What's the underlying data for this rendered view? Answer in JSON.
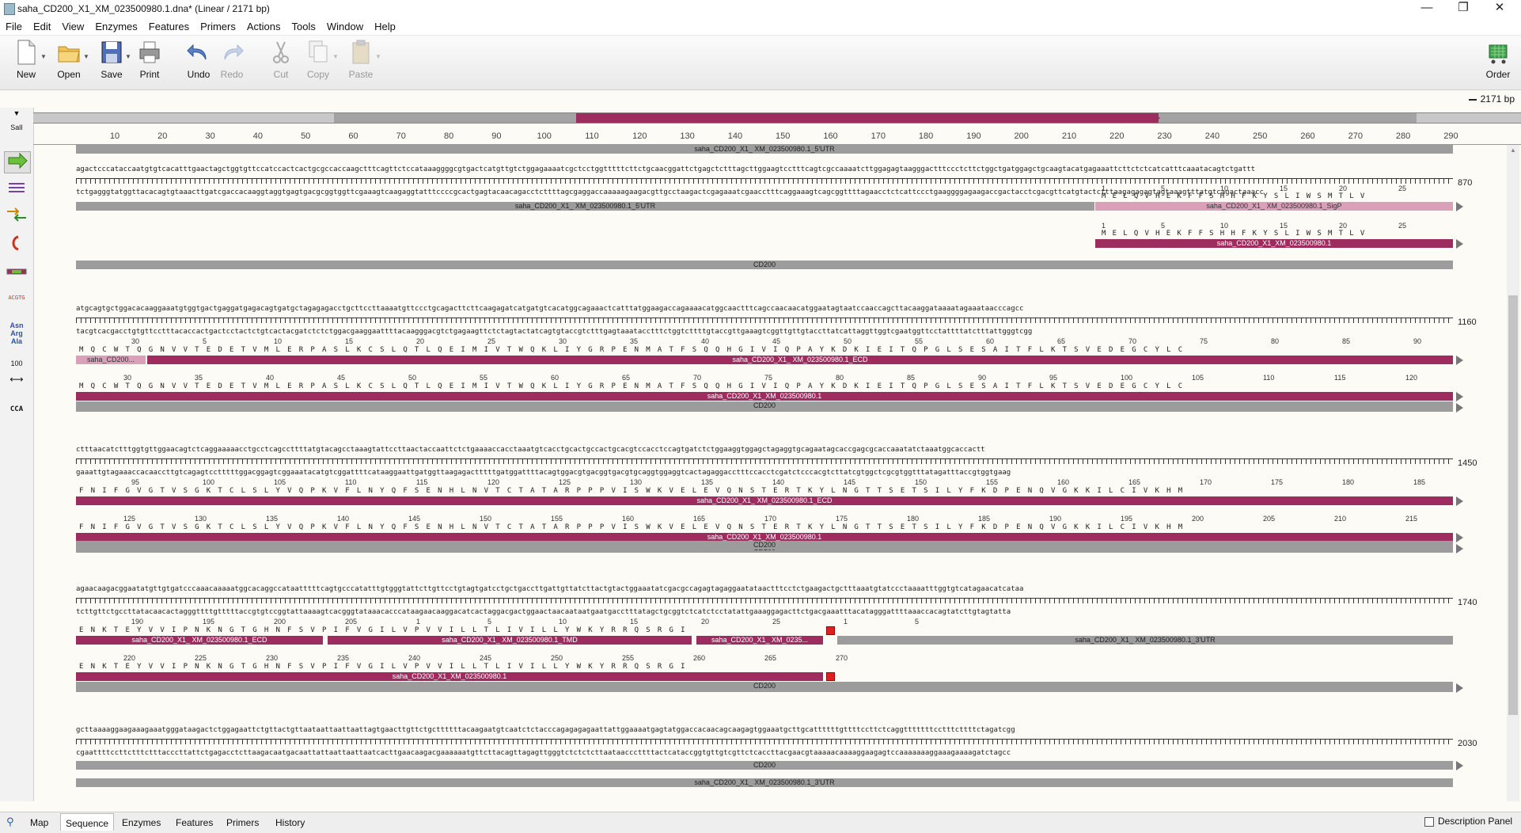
{
  "window": {
    "title": "saha_CD200_X1_XM_023500980.1.dna*  (Linear / 2171 bp)",
    "minimize": "—",
    "restore": "❐",
    "close": "✕"
  },
  "menu": [
    "File",
    "Edit",
    "View",
    "Enzymes",
    "Features",
    "Primers",
    "Actions",
    "Tools",
    "Window",
    "Help"
  ],
  "toolbar": {
    "new": "New",
    "open": "Open",
    "save": "Save",
    "print": "Print",
    "undo": "Undo",
    "redo": "Redo",
    "cut": "Cut",
    "copy": "Copy",
    "paste": "Paste",
    "order": "Order"
  },
  "length_label": "2171 bp",
  "sidebar": {
    "restriction": "SalI",
    "dna_icon": "ACGTG",
    "aa_icon1": "Asn",
    "aa_icon2": "Arg",
    "aa_icon3": "Ala",
    "scale": "100",
    "codon": "CCA"
  },
  "ruler": [
    "10",
    "20",
    "30",
    "40",
    "50",
    "60",
    "70",
    "80",
    "90",
    "100",
    "110",
    "120",
    "130",
    "140",
    "150",
    "160",
    "170",
    "180",
    "190",
    "200",
    "210",
    "220",
    "230",
    "240",
    "250",
    "260",
    "270",
    "280",
    "290"
  ],
  "features": {
    "utr5": "saha_CD200_X1_ XM_023500980.1_5'UTR",
    "sigp": "saha_CD200_X1_ XM_023500980.1_SigP",
    "cds": "saha_CD200_X1_XM_023500980.1",
    "cds2": "saha_CD200_X1_ XM_023500980.1",
    "gene": "CD200",
    "ecd": "saha_CD200_X1_ XM_023500980.1_ECD",
    "ecd_short": "saha_CD200...",
    "tmd": "saha_CD200_X1_ XM_023500980.1_TMD",
    "short": "saha_CD200_X1_ XM_0235...",
    "utr3": "saha_CD200_X1_ XM_023500980.1_3'UTR"
  },
  "rows": [
    {
      "pos": "870",
      "top": "agactcccataccaatgtgtcacatttgaactagctggtgttccatccactcactgcgccaccaagctttcagttctccataaaggggcgtgactcatgttgtctggagaaaatcgctcctggtttttcttctgcaacggattctgagctctttagcttggaagtcctttcagtcgccaaaatcttggagagtaagggactttccctcttctggctgatggagctgcaagtacatgagaaattcttctctcatcatttcaaatacagtctgattt",
      "bot": "tctgagggtatggttacacagtgtaaacttgatcgaccacaaggtaggtgagtgacgcggtggttcgaaagtcaagaggtatttccccgcactgagtacaacagacctcttttagcgaggaccaaaaagaagacgttgcctaagactcgagaaatcgaacctttcaggaaagtcagcggttttagaacctctcattccctgaaggggagaagaccgactacctcgacgttcatgtactctttaagagagagtagtaaagtttatgtcagactaaacc",
      "aa": "MELQVHEKFFSHHFKYSLIWSMTLV",
      "aanums": [
        "1",
        "5",
        "10",
        "15",
        "20",
        "25"
      ]
    },
    {
      "pos": "1160",
      "top": "atgcagtgctggacacaaggaaatgtggtgactgaggatgagacagtgatgctagagagacctgcttccttaaaatgttccctgcagacttcttcaagagatcatgatgtcacatggcagaaactcatttatggaagaccagaaaacatggcaactttcagccaacaacatggaatagtaatccaaccagcttacaaggataaaatagaaataacccagcc",
      "bot": "tacgtcacgacctgtgttcctttacaccactgactcctactctgtcactacgatctctctggacgaaggaattttacaagggacgtctgagaagttctctagtactatcagtgtaccgtctttgagtaaatacctttctggtcttttgtaccgttgaaagtcggttgttgtaccttatcattaggttggtcgaatggttcctattttatctttattgggtcgg",
      "aa": "MQCWTQGNVVTEDETVMLERPASLKCSLQTLQEIMIVTWQKLIYGRPENMATFSQQHGIVIQPAYKDKIEITQPGLSESAITFLKTSVEDEGCYLC",
      "aanums": [
        "30",
        "5",
        "10",
        "15",
        "20",
        "25",
        "30",
        "35",
        "40",
        "45",
        "50",
        "55",
        "60",
        "65",
        "70",
        "75",
        "80",
        "85",
        "90"
      ],
      "aanums2": [
        "30",
        "35",
        "40",
        "45",
        "50",
        "55",
        "60",
        "65",
        "70",
        "75",
        "80",
        "85",
        "90",
        "95",
        "100",
        "105",
        "110",
        "115",
        "120"
      ]
    },
    {
      "pos": "1450",
      "top": "ctttaacatctttggtgttggaacagtctcaggaaaaacctgcctcagccttttatgtacagcctaaagtattccttaactaccaattctctgaaaaccacctaaatgtcacctgcactgccactgcacgtccacctccagtgatctctggaaggtggagctagaggtgcagaatagcaccgagcgcaccaaatatctaaatggcaccactt",
      "bot": "gaaattgtagaaaccacaaccttgtcagagtcctttttggacggagtcggaaatacatgtcggattttcataaggaattgatggttaagagactttttgatggattttacagtggacgtgacggtgacgtgcaggtggaggtcactagaggacctttccacctcgatctcccacgtcttatcgtggctcgcgtggtttatagatttaccgtggtgaag",
      "aa": "FNIFGVGTVSGKTCLSLYVQPKVFLNYQFSENHLNVTCTATARPPPVISWKVELEVQNSTERTKYLNGTTSETSILYFKDPENQVGKKILCIVKHM",
      "aanums": [
        "95",
        "100",
        "105",
        "110",
        "115",
        "120",
        "125",
        "130",
        "135",
        "140",
        "145",
        "150",
        "155",
        "160",
        "165",
        "170",
        "175",
        "180",
        "185"
      ],
      "aanums2": [
        "125",
        "130",
        "135",
        "140",
        "145",
        "150",
        "155",
        "160",
        "165",
        "170",
        "175",
        "180",
        "185",
        "190",
        "195",
        "200",
        "205",
        "210",
        "215"
      ]
    },
    {
      "pos": "1740",
      "top": "agaacaagacggaatatgttgtgatcccaaacaaaaatggcacaggccataatttttcagtgcccatatttgtgggtattcttgttcctgtagtgatcctgctgaccttgattgttatcttactgtactggaaatatcgacgccagagtagaggaatataactttcctctgaagactgctttaaatgtatccctaaaatttggtgtcatagaacatcataa",
      "bot": "tcttgttctgccttatacaacactagggttttgtttttaccgtgtccggtattaaaagtcacgggtataaacacccataagaacaaggacatcactaggacgactggaactaacaataatgaatgacctttatagctgcggtctcatctcctatattgaaaggagacttctgacgaaatttacatagggattttaaaccacagtatcttgtagtatta",
      "aa": "ENKTEYVVIPNKNGTGHNFSVPIFVGILVPVVILLTLIVILLYWKYRRQSRGI",
      "aanums": [
        "190",
        "195",
        "200",
        "205",
        "1",
        "5",
        "10",
        "15",
        "20",
        "25",
        "1",
        "5"
      ],
      "aanums2": [
        "220",
        "225",
        "230",
        "235",
        "240",
        "245",
        "250",
        "255",
        "260",
        "265",
        "270"
      ]
    },
    {
      "pos": "2030",
      "top": "gcttaaaaggaagaaagaaatgggataagactctggagaattctgttactgttaataattaattaattagtgaacttgttctgcttttttacaagaatgtcaatctctacccagagagagaattattggaaaatgagtatggaccacaacagcaagagtggaaatgcttgcattttttgttttccttctcaggtttttttcctttcttttctagatcgg",
      "bot": "cgaattttccttctttctttacccttattctgagacctcttaagacaatgacaattattaattaattaatcacttgaacaagacgaaaaaatgttcttacagttagagttgggtctctctcttaataacccttttactcataccggtgttgtcgttctcaccttacgaacgtaaaaacaaaaggaagagtccaaaaaaaggaaagaaaagatctagcc"
    }
  ],
  "bottom_tabs": [
    "Map",
    "Sequence",
    "Enzymes",
    "Features",
    "Primers",
    "History"
  ],
  "description_panel": "Description Panel"
}
